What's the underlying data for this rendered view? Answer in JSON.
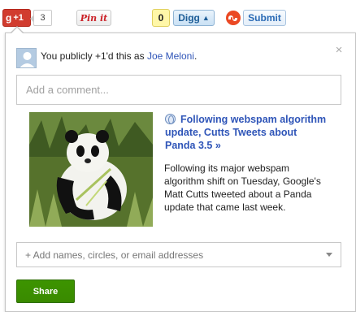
{
  "share_bar": {
    "gplus": {
      "label": "+1",
      "g_letter": "g",
      "count": "3"
    },
    "pinterest": {
      "label": "Pin it"
    },
    "digg": {
      "count": "0",
      "label": "Digg"
    },
    "stumbleupon": {
      "label": "Submit"
    }
  },
  "popup": {
    "status_prefix": "You publicly +1'd this as ",
    "user_name": "Joe Meloni",
    "status_suffix": ".",
    "close_glyph": "×",
    "comment_placeholder": "Add a comment...",
    "article": {
      "title": "Following webspam algorithm update, Cutts Tweets about Panda 3.5 »",
      "description": "Following its major webspam algorithm shift on Tuesday, Google's Matt Cutts tweeted about a Panda update that came last week."
    },
    "audience_placeholder": "+ Add names, circles, or email addresses",
    "share_label": "Share"
  },
  "colors": {
    "gplus_red": "#d13c2f",
    "link_blue": "#2f55b8",
    "share_green": "#3d9400",
    "digg_yellow": "#fff7a8"
  },
  "icons": [
    "google-plus-icon",
    "stumbleupon-icon",
    "globe-icon",
    "close-icon",
    "dropdown-arrow-icon",
    "avatar-icon"
  ]
}
